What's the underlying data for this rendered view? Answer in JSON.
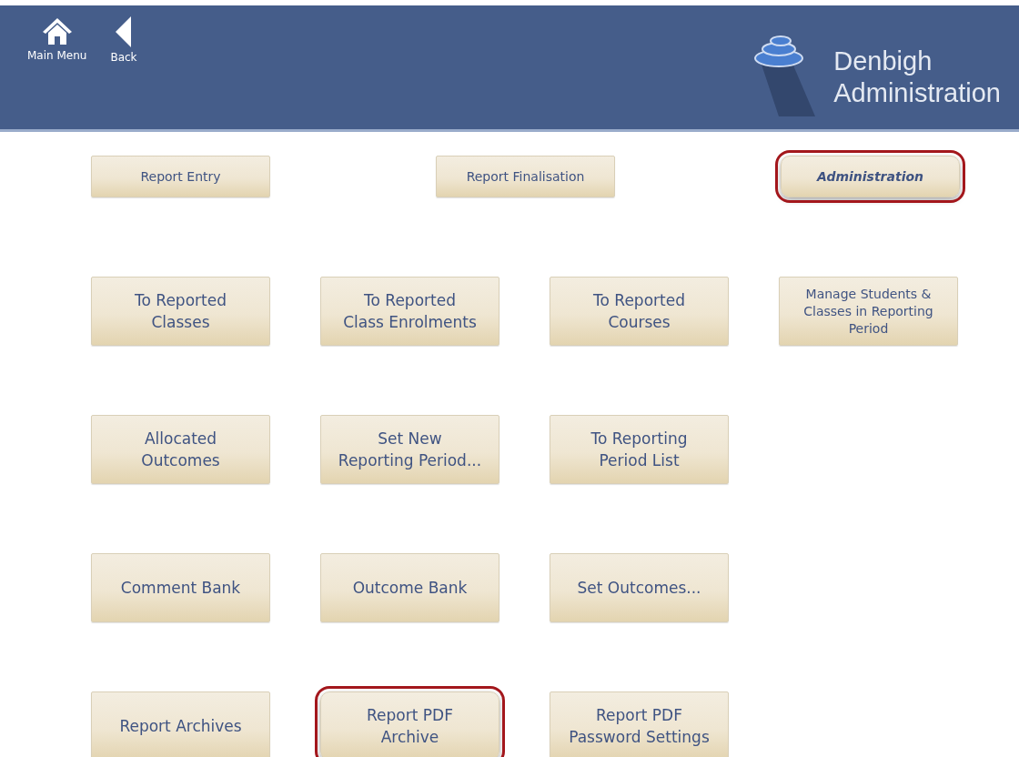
{
  "header": {
    "nav": [
      {
        "kind": "home",
        "label": "Main Menu"
      },
      {
        "kind": "back",
        "label": "Back"
      }
    ],
    "brand": [
      "Denbigh",
      "Administration"
    ]
  },
  "sections": [
    {
      "label": "Report Entry",
      "selected": false,
      "highlighted": false
    },
    {
      "label": "Report Finalisation",
      "selected": false,
      "highlighted": false
    },
    {
      "label": "Administration",
      "selected": true,
      "highlighted": true
    }
  ],
  "rows": [
    [
      {
        "label": "To Reported\nClasses",
        "highlighted": false
      },
      {
        "label": "To Reported\nClass Enrolments",
        "highlighted": false
      },
      {
        "label": "To Reported\nCourses",
        "highlighted": false
      },
      {
        "label": "Manage Students &\nClasses in Reporting\nPeriod",
        "highlighted": false
      }
    ],
    [
      {
        "label": "Allocated\nOutcomes",
        "highlighted": false
      },
      {
        "label": "Set New\nReporting Period...",
        "highlighted": false
      },
      {
        "label": "To Reporting\nPeriod List",
        "highlighted": false
      }
    ],
    [
      {
        "label": "Comment Bank",
        "highlighted": false
      },
      {
        "label": "Outcome Bank",
        "highlighted": false
      },
      {
        "label": "Set Outcomes...",
        "highlighted": false
      }
    ],
    [
      {
        "label": "Report Archives",
        "highlighted": false
      },
      {
        "label": "Report PDF\nArchive",
        "highlighted": true
      },
      {
        "label": "Report PDF\nPassword Settings",
        "highlighted": false
      }
    ]
  ]
}
